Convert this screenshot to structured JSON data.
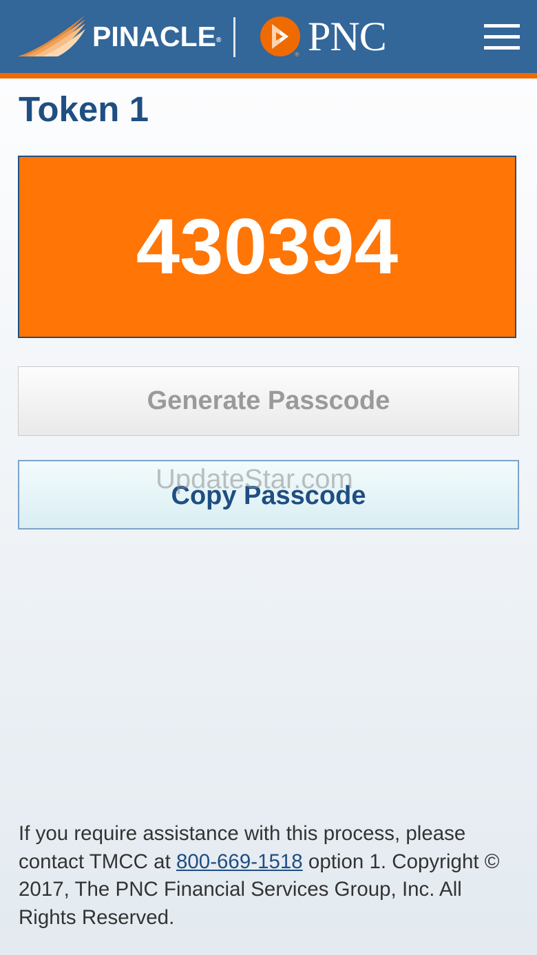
{
  "header": {
    "pinacle_logo_text": "PINACLE",
    "pinacle_registered": "®",
    "pnc_logo_text": "PNC",
    "pnc_registered": "®",
    "menu_icon": "hamburger-menu-icon"
  },
  "page": {
    "title": "Token 1"
  },
  "passcode": {
    "value": "430394"
  },
  "buttons": {
    "generate_label": "Generate Passcode",
    "copy_label": "Copy Passcode"
  },
  "watermark": "UpdateStar.com",
  "footer": {
    "assistance_prefix": "If you require assistance with this process, please contact TMCC at",
    "phone": "800-669-1518",
    "assistance_suffix": "option 1.",
    "copyright": "Copyright © 2017, The PNC Financial Services Group, Inc. All Rights Reserved."
  },
  "colors": {
    "header_blue": "#336699",
    "accent_orange": "#ef6a00",
    "passcode_orange": "#ff7506",
    "title_blue": "#1f4e82"
  }
}
